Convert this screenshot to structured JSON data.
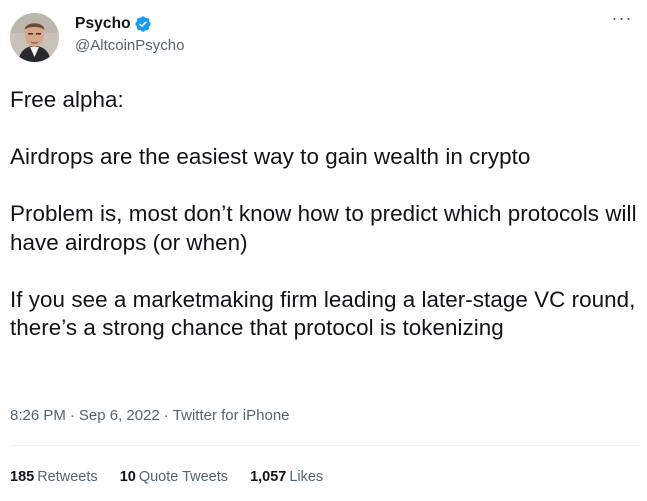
{
  "author": {
    "display_name": "Psycho",
    "handle": "@AltcoinPsycho",
    "verified_icon": "verified-badge-icon",
    "verified_color": "#1d9bf0"
  },
  "more_menu": {
    "icon": "more-horizontal-icon",
    "label": "···"
  },
  "tweet": {
    "paragraphs": [
      "Free alpha:",
      "Airdrops are the easiest way to gain wealth in crypto",
      "Problem is, most don’t know how to predict which protocols will have airdrops (or when)",
      "If you see a marketmaking firm leading a later-stage VC round, there’s a strong chance that protocol is tokenizing"
    ]
  },
  "meta": {
    "time": "8:26 PM",
    "date": "Sep 6, 2022",
    "source": "Twitter for iPhone",
    "separator": "·"
  },
  "stats": {
    "retweets_count": "185",
    "retweets_label": "Retweets",
    "quotes_count": "10",
    "quotes_label": "Quote Tweets",
    "likes_count": "1,057",
    "likes_label": "Likes"
  },
  "colors": {
    "text_primary": "#0f1419",
    "text_secondary": "#536471",
    "divider": "#eff3f4"
  }
}
